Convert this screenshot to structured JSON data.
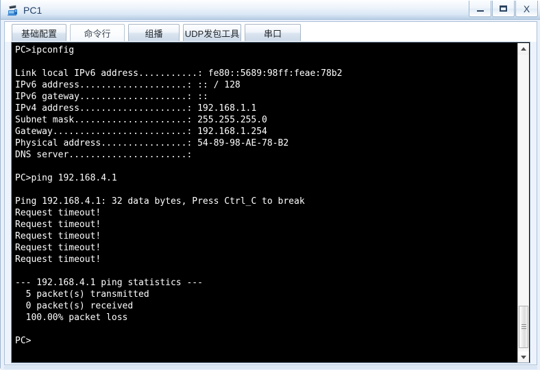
{
  "window": {
    "title": "PC1",
    "icon": "pc-device-icon",
    "buttons": [
      {
        "name": "minimize",
        "label": "—"
      },
      {
        "name": "maximize",
        "label": "□"
      },
      {
        "name": "close",
        "label": "X"
      }
    ]
  },
  "tabs": [
    {
      "label": "基础配置",
      "active": false
    },
    {
      "label": "命令行",
      "active": true
    },
    {
      "label": "组播",
      "active": false
    },
    {
      "label": "UDP发包工具",
      "active": false
    },
    {
      "label": "串口",
      "active": false
    }
  ],
  "console": {
    "background": "#000000",
    "foreground": "#ffffff",
    "text": "PC>ipconfig\n\nLink local IPv6 address...........: fe80::5689:98ff:feae:78b2\nIPv6 address....................: :: / 128\nIPv6 gateway....................: ::\nIPv4 address....................: 192.168.1.1\nSubnet mask.....................: 255.255.255.0\nGateway.........................: 192.168.1.254\nPhysical address................: 54-89-98-AE-78-B2\nDNS server......................:\n\nPC>ping 192.168.4.1\n\nPing 192.168.4.1: 32 data bytes, Press Ctrl_C to break\nRequest timeout!\nRequest timeout!\nRequest timeout!\nRequest timeout!\nRequest timeout!\n\n--- 192.168.4.1 ping statistics ---\n  5 packet(s) transmitted\n  0 packet(s) received\n  100.00% packet loss\n\nPC>",
    "commands": [
      "ipconfig",
      "ping 192.168.4.1"
    ],
    "ipconfig": {
      "link_local_ipv6_address": "fe80::5689:98ff:feae:78b2",
      "ipv6_address": ":: / 128",
      "ipv6_gateway": "::",
      "ipv4_address": "192.168.1.1",
      "subnet_mask": "255.255.255.0",
      "gateway": "192.168.1.254",
      "physical_address": "54-89-98-AE-78-B2",
      "dns_server": ""
    },
    "ping": {
      "target": "192.168.4.1",
      "data_bytes": "32",
      "banner": "Ping 192.168.4.1: 32 data bytes, Press Ctrl_C to break",
      "replies": [
        "Request timeout!",
        "Request timeout!",
        "Request timeout!",
        "Request timeout!",
        "Request timeout!"
      ],
      "statistics_header": "--- 192.168.4.1 ping statistics ---",
      "transmitted": "5 packet(s) transmitted",
      "received": "0 packet(s) received",
      "loss": "100.00% packet loss"
    },
    "prompt": "PC>"
  },
  "scrollbar": {
    "up_arrow": "▲",
    "down_arrow": "▼",
    "position_percent": 85
  },
  "colors": {
    "title_bar_accent": "#b9cfe4",
    "window_bg": "#eaf0fa",
    "border": "#9cb4cf",
    "console_bg": "#000000",
    "console_fg": "#ffffff",
    "title_text": "#1f3f66"
  }
}
